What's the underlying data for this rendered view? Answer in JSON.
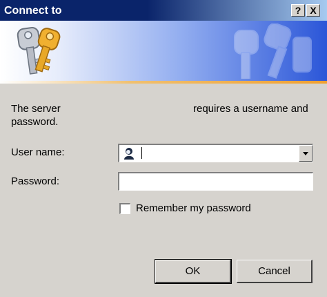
{
  "window": {
    "title": "Connect to",
    "help_label": "?",
    "close_label": "X"
  },
  "message": {
    "line1_start": "The server",
    "line1_end": "requires a username and",
    "line2": "password."
  },
  "form": {
    "username_label": "User name:",
    "username_value": "",
    "password_label": "Password:",
    "password_value": "",
    "remember_label": "Remember my password",
    "remember_checked": false
  },
  "buttons": {
    "ok": "OK",
    "cancel": "Cancel"
  },
  "icons": {
    "banner": "keys-icon",
    "user": "user-icon",
    "dropdown": "chevron-down-icon"
  }
}
